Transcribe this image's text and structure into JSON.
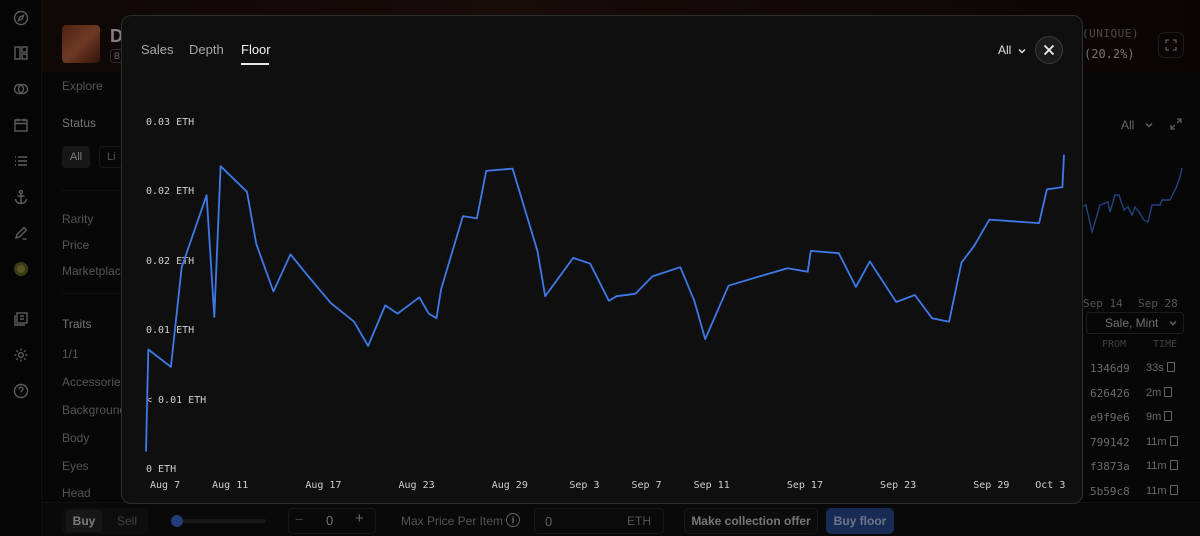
{
  "background": {
    "collection_initial": "D",
    "badge": "B",
    "unique_label": "(UNIQUE)",
    "unique_pct": "(20.2%)",
    "sidebar": {
      "explore": "Explore",
      "status": "Status",
      "status_all": "All",
      "status_listed": "Li",
      "rarity": "Rarity",
      "price": "Price",
      "marketplace": "Marketplac",
      "traits": "Traits",
      "trait_1_1": "1/1",
      "accessories": "Accessories",
      "background": "Background",
      "body": "Body",
      "eyes": "Eyes",
      "head": "Head"
    },
    "right_panel": {
      "range": "All",
      "dates": [
        "Sep 14",
        "Sep 28"
      ],
      "filter": "Sale, Mint",
      "col_from": "FROM",
      "col_time": "TIME",
      "rows": [
        {
          "from": "1346d9",
          "time": "33s"
        },
        {
          "from": "626426",
          "time": "2m"
        },
        {
          "from": "e9f9e6",
          "time": "9m"
        },
        {
          "from": "799142",
          "time": "11m"
        },
        {
          "from": "f3873a",
          "time": "11m"
        },
        {
          "from": "5b59c8",
          "time": "11m"
        }
      ]
    },
    "bottom_bar": {
      "buy": "Buy",
      "sell": "Sell",
      "minus": "−",
      "quantity": "0",
      "plus": "+",
      "max_price_label": "Max Price Per Item",
      "max_price_value": "0",
      "currency": "ETH",
      "offer_button": "Make collection offer",
      "buy_floor_button": "Buy floor"
    }
  },
  "modal": {
    "tabs": [
      {
        "label": "Sales",
        "active": false
      },
      {
        "label": "Depth",
        "active": false
      },
      {
        "label": "Floor",
        "active": true
      }
    ],
    "range": "All",
    "close_icon": "close-icon"
  },
  "colors": {
    "line": "#3f79e6",
    "accent_button": "#2c4f9c"
  },
  "chart_data": {
    "type": "line",
    "title": "",
    "xlabel": "",
    "ylabel": "",
    "grid": false,
    "y_tick_labels": [
      "0 ETH",
      "< 0.01 ETH",
      "0.01 ETH",
      "0.02 ETH",
      "0.02 ETH",
      "0.03 ETH"
    ],
    "ylim": [
      0,
      0.03
    ],
    "x_tick_labels": [
      "Aug 7",
      "Aug 11",
      "Aug 17",
      "Aug 23",
      "Aug 29",
      "Sep 3",
      "Sep 7",
      "Sep 11",
      "Sep 17",
      "Sep 23",
      "Sep 29",
      "Oct 3"
    ],
    "x_tick_days": [
      0,
      4,
      10,
      16,
      22,
      27,
      31,
      35,
      41,
      47,
      53,
      57
    ],
    "series": [
      {
        "x": [
          0,
          0.15,
          1.6,
          2.3,
          3.9,
          4.4,
          4.8,
          6.5,
          7.1,
          8.2,
          9.3,
          10.4,
          11.9,
          13.4,
          14.3,
          15.4,
          16.2,
          17.6,
          18.2,
          18.7,
          19.0,
          20.4,
          21.3,
          21.9,
          23.6,
          25.2,
          25.7,
          27.5,
          28.6,
          29.8,
          30.3,
          31.5,
          32.6,
          34.4,
          35.3,
          36.0,
          37.5,
          39.5,
          41.3,
          42.6,
          42.8,
          44.6,
          45.7,
          46.6,
          48.3,
          49.5,
          50.6,
          51.7,
          52.5,
          53.3,
          54.3,
          57.5,
          58.0,
          59.0,
          59.1
        ],
        "y": [
          0.0015,
          0.0103,
          0.0088,
          0.0174,
          0.0236,
          0.0131,
          0.0261,
          0.0239,
          0.0194,
          0.0153,
          0.0185,
          0.0167,
          0.0143,
          0.0127,
          0.0106,
          0.0141,
          0.0134,
          0.0148,
          0.0134,
          0.013,
          0.0155,
          0.0218,
          0.0216,
          0.0257,
          0.0259,
          0.0188,
          0.0149,
          0.0182,
          0.0177,
          0.0145,
          0.0149,
          0.0151,
          0.0166,
          0.0174,
          0.0145,
          0.0112,
          0.0158,
          0.0166,
          0.0173,
          0.017,
          0.0188,
          0.0186,
          0.0157,
          0.0179,
          0.0144,
          0.015,
          0.013,
          0.0127,
          0.0178,
          0.0192,
          0.0215,
          0.0212,
          0.0241,
          0.0243,
          0.0271
        ]
      }
    ]
  }
}
